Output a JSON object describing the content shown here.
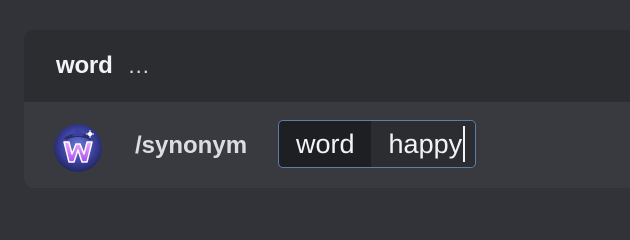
{
  "header": {
    "title": "word",
    "ellipsis": "..."
  },
  "input": {
    "command": "/synonym",
    "option_name": "word",
    "option_value": "happy"
  },
  "colors": {
    "background": "#313338",
    "panel": "#2b2d31",
    "input_row": "#383a40",
    "focus_border": "#5b7fa6",
    "text": "#f2f3f5"
  },
  "icons": {
    "avatar": "w-wizard-logo-avatar"
  }
}
